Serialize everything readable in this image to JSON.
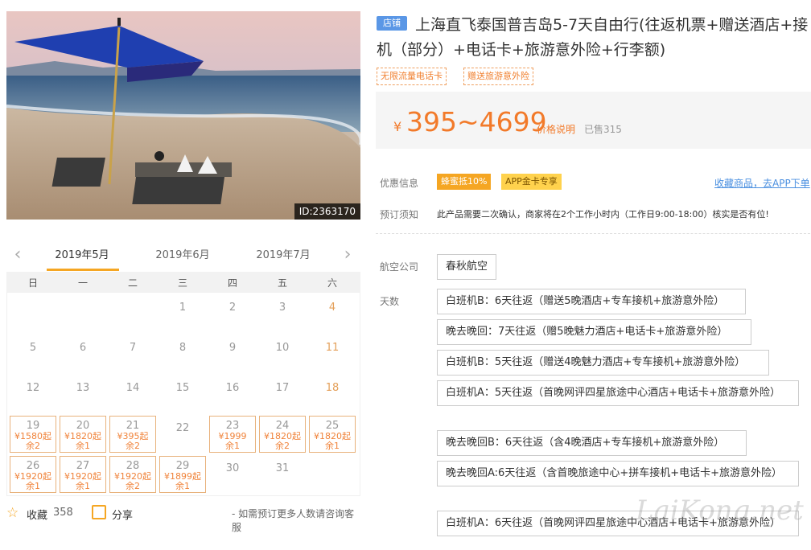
{
  "photo": {
    "id_badge": "ID:2363170"
  },
  "calendar": {
    "prev_icon": "chevron-left-icon",
    "next_icon": "chevron-right-icon",
    "months": [
      "2019年5月",
      "2019年6月",
      "2019年7月"
    ],
    "weekdays": [
      "日",
      "一",
      "二",
      "三",
      "四",
      "五",
      "六"
    ],
    "rows": [
      [
        {
          "d": ""
        },
        {
          "d": ""
        },
        {
          "d": ""
        },
        {
          "d": "1"
        },
        {
          "d": "2"
        },
        {
          "d": "3"
        },
        {
          "d": "4"
        }
      ],
      [
        {
          "d": "5"
        },
        {
          "d": "6"
        },
        {
          "d": "7"
        },
        {
          "d": "8"
        },
        {
          "d": "9"
        },
        {
          "d": "10"
        },
        {
          "d": "11"
        }
      ],
      [
        {
          "d": "12"
        },
        {
          "d": "13"
        },
        {
          "d": "14"
        },
        {
          "d": "15"
        },
        {
          "d": "16"
        },
        {
          "d": "17"
        },
        {
          "d": "18"
        }
      ],
      [
        {
          "d": "19",
          "p": "¥1580起",
          "r": "余2"
        },
        {
          "d": "20",
          "p": "¥1820起",
          "r": "余1"
        },
        {
          "d": "21",
          "p": "¥395起",
          "r": "余2"
        },
        {
          "d": "22"
        },
        {
          "d": "23",
          "p": "¥1999",
          "r": "余1"
        },
        {
          "d": "24",
          "p": "¥1820起",
          "r": "余2"
        },
        {
          "d": "25",
          "p": "¥1820起",
          "r": "余1"
        }
      ],
      [
        {
          "d": "26",
          "p": "¥1920起",
          "r": "余1"
        },
        {
          "d": "27",
          "p": "¥1920起",
          "r": "余1"
        },
        {
          "d": "28",
          "p": "¥1920起",
          "r": "余2"
        },
        {
          "d": "29",
          "p": "¥1899起",
          "r": "余1"
        },
        {
          "d": "30"
        },
        {
          "d": "31"
        },
        {
          "d": ""
        }
      ]
    ]
  },
  "footer": {
    "favorite_label": "收藏",
    "favorite_count": "358",
    "share_label": "分享",
    "note": "- 如需预订更多人数请咨询客服"
  },
  "product": {
    "store_badge": "店铺",
    "title": "上海直飞泰国普吉岛5-7天自由行(往返机票+赠送酒店+接机（部分）+电话卡+旅游意外险+行李额)",
    "tags": [
      "无限流量电话卡",
      "赠送旅游意外险"
    ],
    "price_symbol": "¥",
    "price_range": "395~4699",
    "price_note": "价格说明",
    "sold": "已售315"
  },
  "promo": {
    "label": "优惠信息",
    "chips": [
      "蜂蜜抵10%",
      "APP金卡专享"
    ],
    "app_link": "收藏商品，去APP下单"
  },
  "notice": {
    "label": "预订须知",
    "text": "此产品需要二次确认，商家将在2个工作小时内（工作日9:00-18:00）核实是否有位!"
  },
  "airline": {
    "label": "航空公司",
    "value": "春秋航空"
  },
  "days": {
    "label": "天数",
    "options": [
      "白班机B：6天往返（赠送5晚酒店+专车接机+旅游意外险）",
      "晚去晚回：7天往返（赠5晚魅力酒店+电话卡+旅游意外险）",
      "白班机B：5天往返（赠送4晚魅力酒店+专车接机+旅游意外险）",
      "白班机A：5天往返（首晚网评四星旅途中心酒店+电话卡+旅游意外险）",
      "晚去晚回B：6天往返（含4晚酒店+专车接机+旅游意外险）",
      "晚去晚回A:6天往返（含首晚旅途中心+拼车接机+电话卡+旅游意外险）",
      "白班机A：6天往返（首晚网评四星旅途中心酒店+电话卡+旅游意外险）"
    ]
  },
  "watermark": "LaiKong.net",
  "colors": {
    "accent": "#f27a2a",
    "store_badge": "#5a97e6",
    "promo1": "#f5a623",
    "promo2": "#ffd24d",
    "link": "#4a8fe0"
  }
}
